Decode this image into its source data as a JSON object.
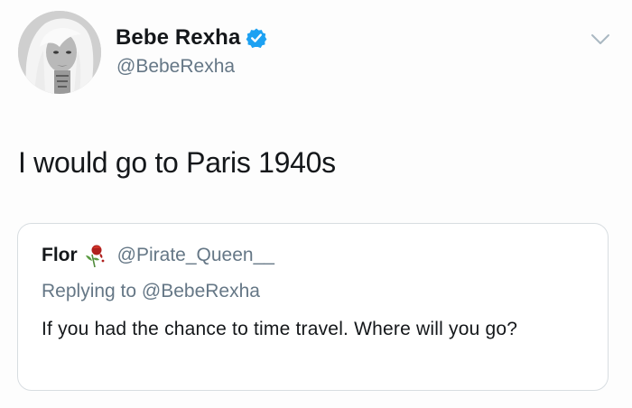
{
  "tweet": {
    "author": {
      "display_name": "Bebe Rexha",
      "handle": "@BebeRexha",
      "verified": true,
      "avatar_icon": "profile-photo"
    },
    "text": "I would go to Paris 1940s",
    "menu_icon": "chevron-down-icon"
  },
  "quoted_tweet": {
    "author": {
      "display_name": "Flor",
      "emoji_icon": "wilted-rose-icon",
      "handle": "@Pirate_Queen__"
    },
    "replying_to": "Replying to @BebeRexha",
    "text": "If you had the chance to time travel. Where will you go?"
  },
  "colors": {
    "primary_text": "#14171a",
    "secondary_text": "#657786",
    "verified_blue": "#1da1f2",
    "card_border": "#d8dde1"
  }
}
